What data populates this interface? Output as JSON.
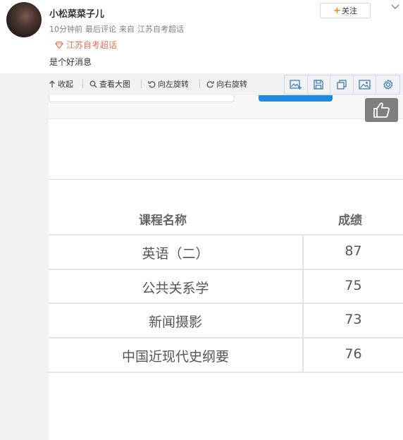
{
  "post": {
    "username": "小松菜菜子儿",
    "time": "10分钟前",
    "meta_tag": "最后评论",
    "source_prefix": "来自",
    "source": "江苏自考超话",
    "supertopic": "江苏自考超话",
    "text": "是个好消息"
  },
  "header_actions": {
    "follow_label": "关注"
  },
  "toolbar": {
    "collapse": "收起",
    "view_large": "查看大图",
    "rotate_left": "向左旋转",
    "rotate_right": "向右旋转"
  },
  "table": {
    "headers": [
      "课程名称",
      "成绩"
    ],
    "rows": [
      {
        "course": "英语（二）",
        "score": "87"
      },
      {
        "course": "公共关系学",
        "score": "75"
      },
      {
        "course": "新闻摄影",
        "score": "73"
      },
      {
        "course": "中国近现代史纲要",
        "score": "76"
      }
    ]
  },
  "icons": {
    "accent": "#eb7350",
    "follow_plus": "#ff8200",
    "toolbar_icon": "#2d75b7"
  }
}
